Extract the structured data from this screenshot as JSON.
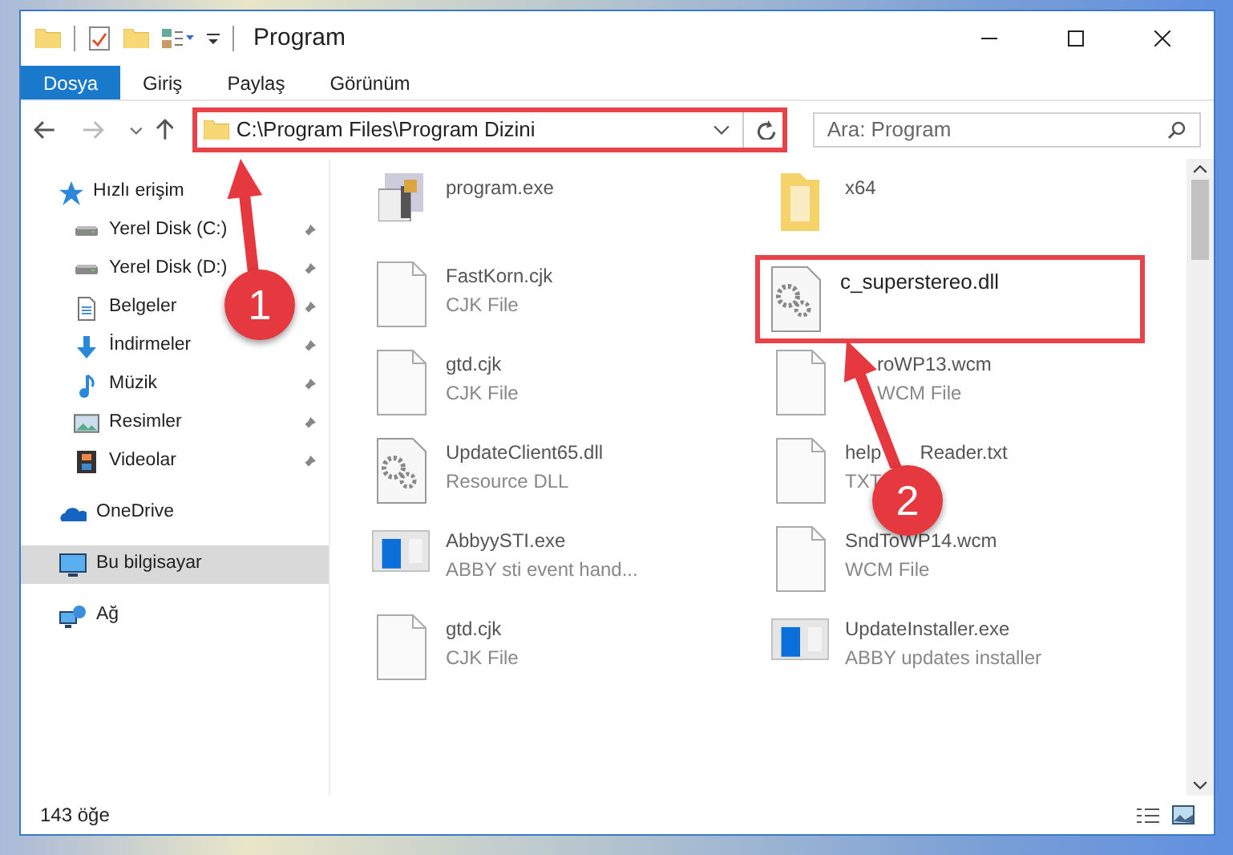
{
  "window": {
    "title": "Program"
  },
  "ribbon_tabs": [
    {
      "label": "Dosya",
      "selected": true
    },
    {
      "label": "Giriş",
      "selected": false
    },
    {
      "label": "Paylaş",
      "selected": false
    },
    {
      "label": "Görünüm",
      "selected": false
    }
  ],
  "address": {
    "path": "C:\\Program Files\\Program Dizini"
  },
  "search": {
    "placeholder": "Ara: Program"
  },
  "sidebar": {
    "items": [
      {
        "label": "Hızlı erişim",
        "kind": "star",
        "selected": false,
        "children": [
          {
            "label": "Yerel Disk (C:)",
            "kind": "drive",
            "pinned": true,
            "selected": false
          },
          {
            "label": "Yerel Disk (D:)",
            "kind": "drive",
            "pinned": true,
            "selected": false
          },
          {
            "label": "Belgeler",
            "kind": "doc",
            "pinned": true,
            "selected": false
          },
          {
            "label": "İndirmeler",
            "kind": "download",
            "pinned": true,
            "selected": false
          },
          {
            "label": "Müzik",
            "kind": "music",
            "pinned": true,
            "selected": false
          },
          {
            "label": "Resimler",
            "kind": "pictures",
            "pinned": true,
            "selected": false
          },
          {
            "label": "Videolar",
            "kind": "video",
            "pinned": true,
            "selected": false
          }
        ]
      },
      {
        "label": "OneDrive",
        "kind": "cloud",
        "selected": false
      },
      {
        "label": "Bu bilgisayar",
        "kind": "pc",
        "selected": true
      },
      {
        "label": "Ağ",
        "kind": "network",
        "selected": false
      }
    ]
  },
  "files": [
    {
      "name": "program.exe",
      "kind": "exe"
    },
    {
      "name": "x64",
      "kind": "folder"
    },
    {
      "name": "FastKorn.cjk",
      "type": "CJK File",
      "kind": "file"
    },
    {
      "name": "c_superstereo.dll",
      "kind": "dll",
      "highlighted": true
    },
    {
      "name": "gtd.cjk",
      "type": "CJK File",
      "kind": "file"
    },
    {
      "name": "roWP13.wcm",
      "type": "WCM File",
      "kind": "file",
      "partly_covered": true
    },
    {
      "name": "UpdateClient65.dll",
      "type": "Resource DLL",
      "kind": "dll"
    },
    {
      "name": "help",
      "name_end": "Reader.txt",
      "type": "TXT",
      "kind": "file"
    },
    {
      "name": "AbbyySTI.exe",
      "type": "ABBY sti event hand...",
      "kind": "app"
    },
    {
      "name": "SndToWP14.wcm",
      "type": "WCM File",
      "kind": "file"
    },
    {
      "name": "gtd.cjk",
      "type": "CJK File",
      "kind": "file"
    },
    {
      "name": "UpdateInstaller.exe",
      "type": "ABBY updates installer",
      "kind": "app"
    }
  ],
  "status_bar": {
    "count": "143 öğe"
  },
  "annotations": [
    {
      "label": "1"
    },
    {
      "label": "2"
    }
  ]
}
